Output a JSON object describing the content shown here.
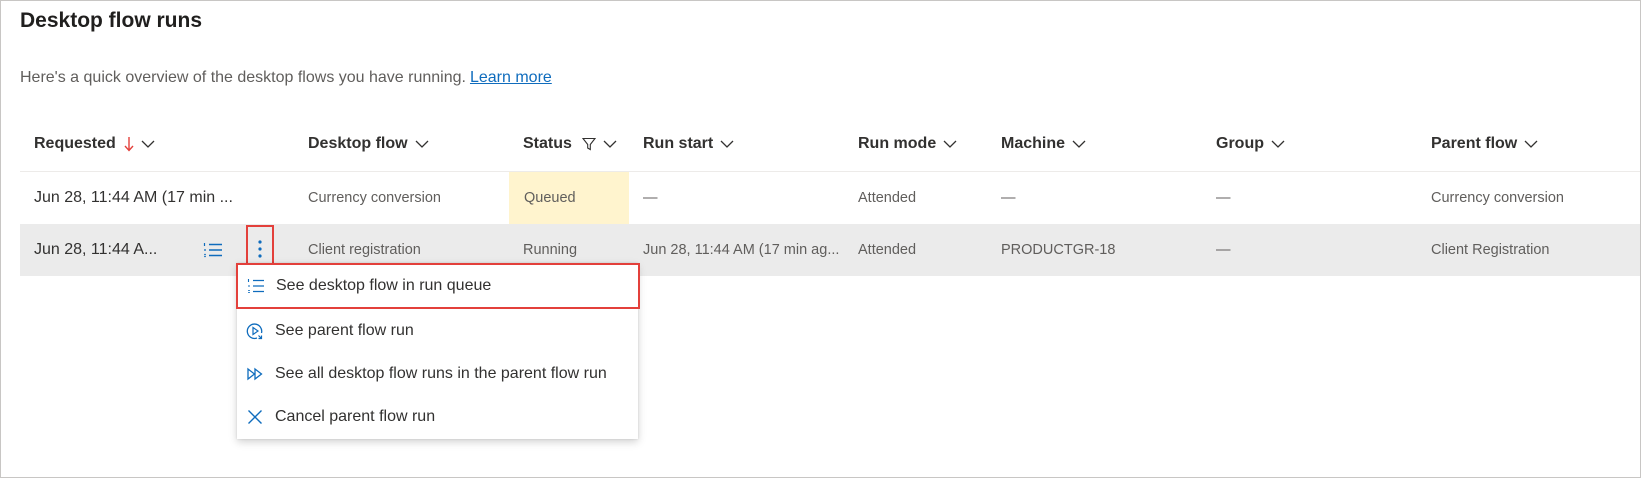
{
  "page": {
    "title": "Desktop flow runs",
    "intro_text": "Here's a quick overview of the desktop flows you have running.",
    "learn_more": "Learn more"
  },
  "columns": [
    {
      "label": "Requested"
    },
    {
      "label": "Desktop flow"
    },
    {
      "label": "Status"
    },
    {
      "label": "Run start"
    },
    {
      "label": "Run mode"
    },
    {
      "label": "Machine"
    },
    {
      "label": "Group"
    },
    {
      "label": "Parent flow"
    }
  ],
  "rows": [
    {
      "requested": "Jun 28, 11:44 AM (17 min ...",
      "desktop_flow": "Currency conversion",
      "status": "Queued",
      "run_start": "—",
      "run_mode": "Attended",
      "machine": "—",
      "group": "—",
      "parent_flow": "Currency conversion"
    },
    {
      "requested": "Jun 28, 11:44 A...",
      "desktop_flow": "Client registration",
      "status": "Running",
      "run_start": "Jun 28, 11:44 AM (17 min ag...",
      "run_mode": "Attended",
      "machine": "PRODUCTGR-18",
      "group": "—",
      "parent_flow": "Client Registration"
    }
  ],
  "context_menu": {
    "items": [
      {
        "label": "See desktop flow in run queue",
        "icon": "run-queue-icon"
      },
      {
        "label": "See parent flow run",
        "icon": "parent-flow-icon"
      },
      {
        "label": "See all desktop flow runs in the parent flow run",
        "icon": "fast-forward-icon"
      },
      {
        "label": "Cancel parent flow run",
        "icon": "close-icon"
      }
    ]
  },
  "colors": {
    "accent": "#0f6cbd",
    "highlight_border": "#e3403b",
    "queued_bg": "#fff4ce",
    "selected_row_bg": "#ebebeb"
  }
}
